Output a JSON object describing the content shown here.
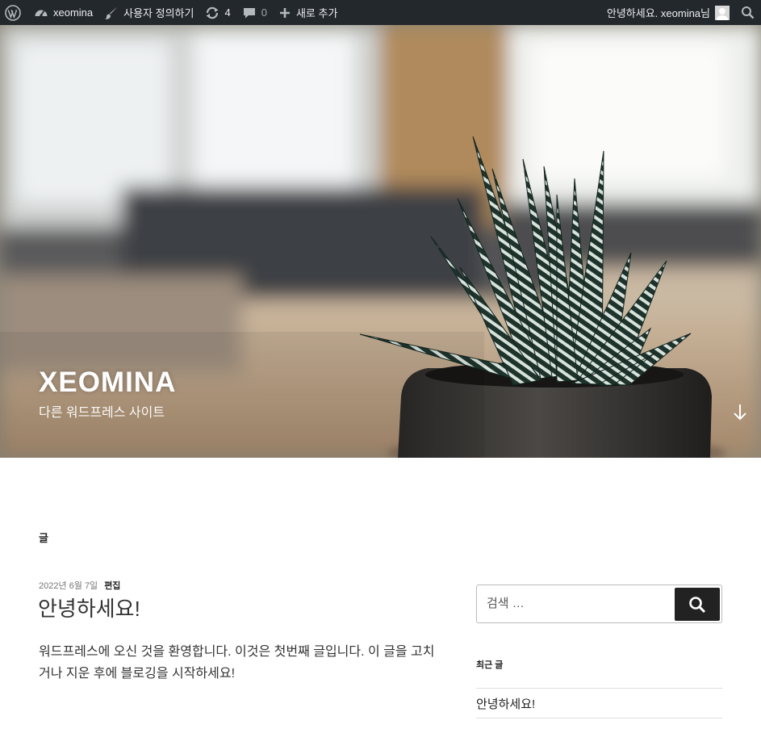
{
  "adminbar": {
    "site_name": "xeomina",
    "customize_label": "사용자 정의하기",
    "updates_count": "4",
    "comments_count": "0",
    "new_label": "새로 추가",
    "greeting": "안녕하세요. xeomina님"
  },
  "header": {
    "site_title": "XEOMINA",
    "tagline": "다른 워드프레스 사이트"
  },
  "main": {
    "section_label": "글",
    "post": {
      "date": "2022년 6월 7일",
      "edit_label": "편집",
      "title": "안녕하세요!",
      "excerpt": "워드프레스에 오신 것을 환영합니다. 이것은 첫번째 글입니다. 이 글을 고치거나 지운 후에 블로깅을 시작하세요!"
    }
  },
  "sidebar": {
    "search_placeholder": "검색 …",
    "recent_title": "최근 글",
    "recent_posts": [
      "안녕하세요!"
    ]
  },
  "colors": {
    "adminbar_bg": "#23282d",
    "search_button_bg": "#222222"
  }
}
